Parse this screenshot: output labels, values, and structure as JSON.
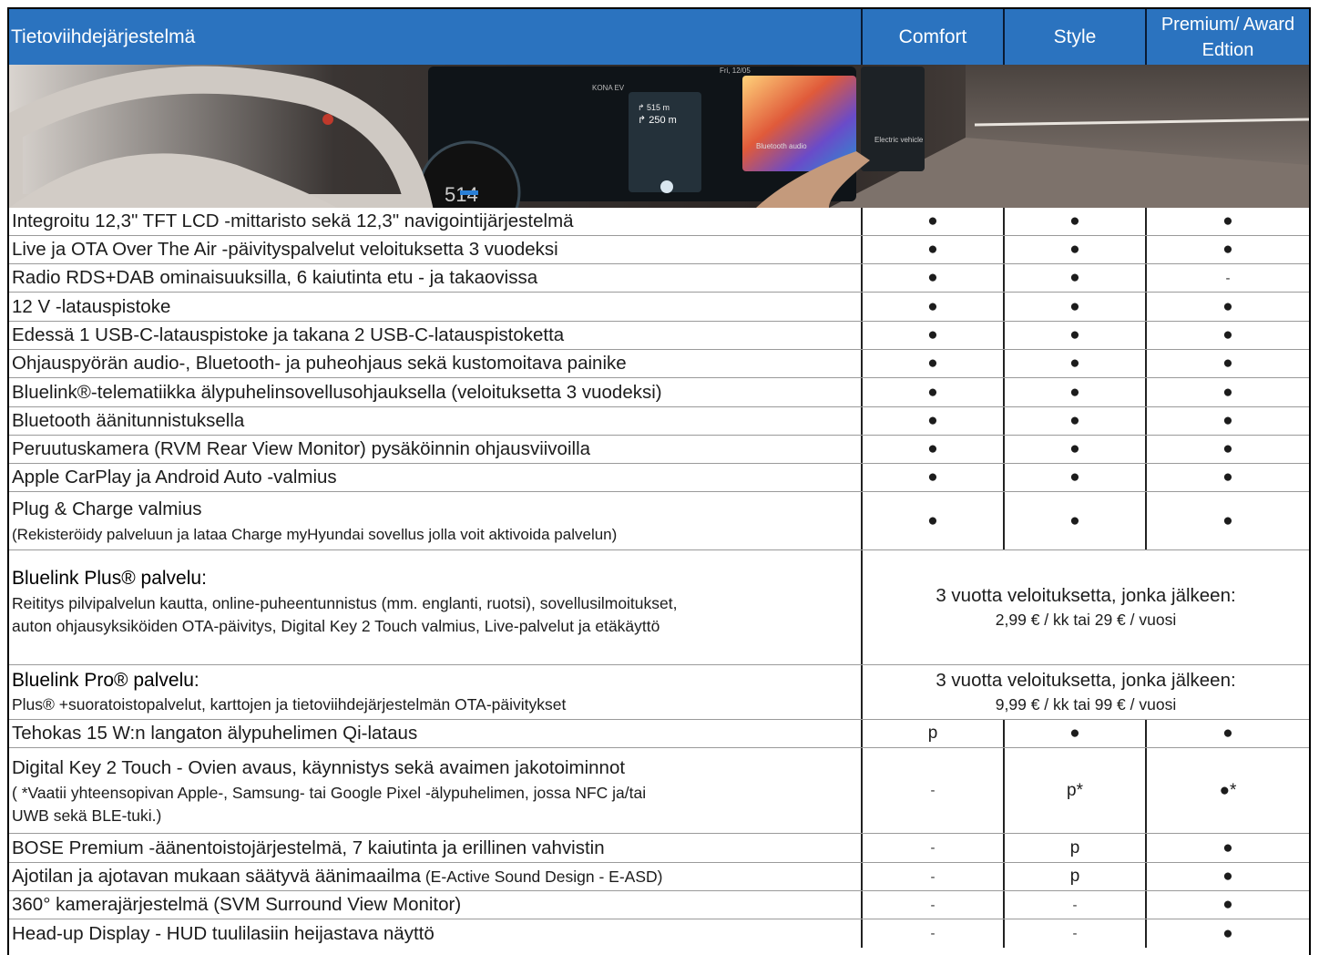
{
  "header": {
    "title": "Tietoviihdejärjestelmä",
    "col1": "Comfort",
    "col2": "Style",
    "col3": "Premium/ Award Edtion"
  },
  "hero": {
    "speed": "514",
    "top_label": "Fri, 12/05",
    "map_title": "KONA EV",
    "trip_top": "↱ 515 m",
    "trip_dist": "↱ 250 m",
    "audio_label": "Bluetooth audio",
    "ev_label": "Electric vehicle"
  },
  "rows": [
    {
      "label": "Integroitu 12,3\" TFT LCD -mittaristo sekä 12,3\" navigointijärjestelmä",
      "v": [
        "●",
        "●",
        "●"
      ]
    },
    {
      "label": "Live ja OTA Over The Air -päivityspalvelut veloituksetta 3 vuodeksi",
      "v": [
        "●",
        "●",
        "●"
      ]
    },
    {
      "label": "Radio RDS+DAB ominaisuuksilla, 6 kaiutinta etu - ja takaovissa",
      "v": [
        "●",
        "●",
        "-"
      ]
    },
    {
      "label": "12 V -latauspistoke",
      "v": [
        "●",
        "●",
        "●"
      ]
    },
    {
      "label": "Edessä 1 USB-C-latauspistoke ja takana 2 USB-C-latauspistoketta",
      "v": [
        "●",
        "●",
        "●"
      ]
    },
    {
      "label": "Ohjauspyörän audio-, Bluetooth- ja puheohjaus sekä kustomoitava painike",
      "v": [
        "●",
        "●",
        "●"
      ]
    },
    {
      "label": "Bluelink®-telematiikka älypuhelinsovellusohjauksella (veloituksetta 3 vuodeksi)",
      "v": [
        "●",
        "●",
        "●"
      ]
    },
    {
      "label": "Bluetooth äänitunnistuksella",
      "v": [
        "●",
        "●",
        "●"
      ]
    },
    {
      "label": "Peruutuskamera (RVM Rear View Monitor)  pysäköinnin ohjausviivoilla",
      "v": [
        "●",
        "●",
        "●"
      ]
    },
    {
      "label": "Apple CarPlay ja Android Auto -valmius",
      "v": [
        "●",
        "●",
        "●"
      ]
    }
  ],
  "plug": {
    "label": "Plug & Charge valmius",
    "sub": "(Rekisteröidy palveluun ja lataa  Charge myHyundai sovellus jolla voit aktivoida palvelun)",
    "v": [
      "●",
      "●",
      "●"
    ]
  },
  "bluelink_plus": {
    "title": "Bluelink Plus® palvelu:",
    "desc1": "Reititys pilvipalvelun kautta, online-puheentunnistus (mm. englanti, ruotsi), sovellusilmoitukset,",
    "desc2": "auton ohjausyksiköiden OTA-päivitys, Digital Key 2 Touch valmius, Live-palvelut ja etäkäyttö",
    "price1": "3 vuotta veloituksetta, jonka jälkeen:",
    "price2": "2,99 € / kk tai 29 € / vuosi"
  },
  "bluelink_pro": {
    "title": "Bluelink Pro® palvelu:",
    "desc": "Plus® +suoratoistopalvelut, karttojen ja tietoviihdejärjestelmän OTA-päivitykset",
    "price1": "3 vuotta veloituksetta, jonka jälkeen:",
    "price2": "9,99 € / kk tai 99 € / vuosi"
  },
  "qi": {
    "label": "Tehokas 15 W:n langaton älypuhelimen Qi-lataus",
    "v": [
      "p",
      "●",
      "●"
    ]
  },
  "dk": {
    "label": "Digital Key 2 Touch - Ovien avaus, käynnistys sekä avaimen jakotoiminnot",
    "sub1": "( *Vaatii yhteensopivan Apple-, Samsung- tai Google Pixel -älypuhelimen, jossa NFC ja/tai",
    "sub2": "UWB sekä BLE-tuki.)",
    "v": [
      "-",
      "p*",
      "●*"
    ]
  },
  "bose": {
    "label": "BOSE Premium -äänentoistojärjestelmä, 7 kaiutinta ja erillinen vahvistin",
    "v": [
      "-",
      "p",
      "●"
    ]
  },
  "sound": {
    "label": "Ajotilan ja ajotavan mukaan säätyvä äänimaailma",
    "label_small": " (E-Active Sound Design - E-ASD)",
    "v": [
      "-",
      "p",
      "●"
    ]
  },
  "svm": {
    "label": "360° kamerajärjestelmä (SVM Surround View Monitor)",
    "v": [
      "-",
      "-",
      "●"
    ]
  },
  "hud": {
    "label": "Head-up Display - HUD tuulilasiin heijastava näyttö",
    "v": [
      "-",
      "-",
      "●"
    ]
  }
}
